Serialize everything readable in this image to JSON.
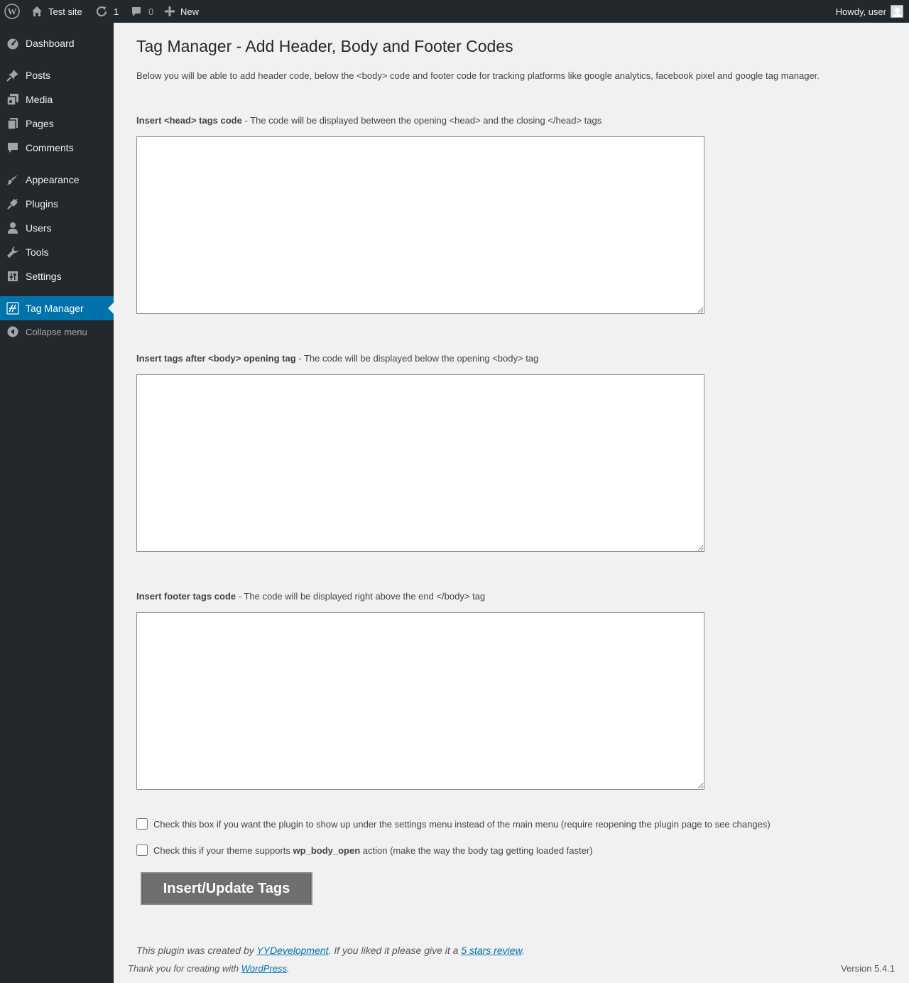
{
  "adminbar": {
    "site_name": "Test site",
    "updates_count": "1",
    "comments_count": "0",
    "new_label": "New",
    "howdy": "Howdy, user"
  },
  "sidebar": {
    "items": [
      {
        "label": "Dashboard",
        "icon": "dashboard-icon"
      },
      {
        "label": "Posts",
        "icon": "pin-icon"
      },
      {
        "label": "Media",
        "icon": "media-icon"
      },
      {
        "label": "Pages",
        "icon": "pages-icon"
      },
      {
        "label": "Comments",
        "icon": "comment-icon"
      },
      {
        "label": "Appearance",
        "icon": "brush-icon"
      },
      {
        "label": "Plugins",
        "icon": "plug-icon"
      },
      {
        "label": "Users",
        "icon": "user-icon"
      },
      {
        "label": "Tools",
        "icon": "wrench-icon"
      },
      {
        "label": "Settings",
        "icon": "sliders-icon"
      },
      {
        "label": "Tag Manager",
        "icon": "tag-manager-icon"
      }
    ],
    "collapse_label": "Collapse menu"
  },
  "main": {
    "title": "Tag Manager - Add Header, Body and Footer Codes",
    "intro": "Below you will be able to add header code, below the <body> code and footer code for tracking platforms like google analytics, facebook pixel and google tag manager.",
    "head_label_bold": "Insert <head> tags code",
    "head_label_rest": " - The code will be displayed between the opening <head> and the closing </head> tags",
    "head_value": "",
    "body_label_bold": "Insert tags after <body> opening tag",
    "body_label_rest": " - The code will be displayed below the opening <body> tag",
    "body_value": "",
    "footer_label_bold": "Insert footer tags code",
    "footer_label_rest": " - The code will be displayed right above the end </body> tag",
    "footer_value": "",
    "settings_check_label": "Check this box if you want the plugin to show up under the settings menu instead of the main menu (require reopening the plugin page to see changes)",
    "settings_checked": false,
    "wpbody_check_prefix": "Check this if your theme supports ",
    "wpbody_check_bold": "wp_body_open",
    "wpbody_check_suffix": " action (make the way the body tag getting loaded faster)",
    "wpbody_checked": false,
    "submit_label": "Insert/Update Tags",
    "credit_prefix": "This plugin was created by ",
    "credit_link": "YYDevelopment",
    "credit_middle": ". If you liked it please give it a ",
    "credit_review": "5 stars review",
    "credit_suffix": "."
  },
  "footer": {
    "thanks_prefix": "Thank you for creating with ",
    "thanks_link": "WordPress",
    "thanks_suffix": ".",
    "version": "Version 5.4.1"
  },
  "colors": {
    "adminbar_bg": "#23282d",
    "accent": "#0073aa",
    "page_bg": "#f1f1f1",
    "button_bg": "#6f6f6f"
  }
}
